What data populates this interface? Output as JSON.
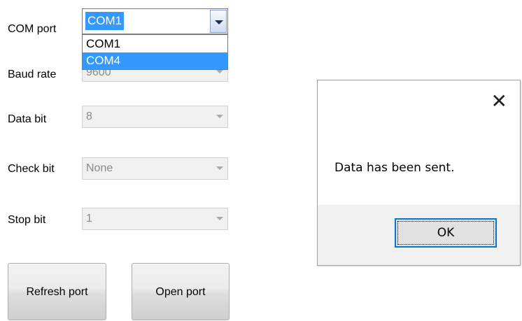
{
  "form": {
    "labels": {
      "com_port": "COM port",
      "baud_rate": "Baud rate",
      "data_bit": "Data bit",
      "check_bit": "Check bit",
      "stop_bit": "Stop bit"
    },
    "com_port": {
      "selected": "COM1",
      "options": [
        "COM1",
        "COM4"
      ],
      "highlighted": "COM4"
    },
    "baud_rate_value": "9600",
    "data_bit_value": "8",
    "check_bit_value": "None",
    "stop_bit_value": "1",
    "buttons": {
      "refresh": "Refresh port",
      "open": "Open port"
    }
  },
  "dialog": {
    "message": "Data has been sent.",
    "ok_label": "OK",
    "close_glyph": "✕"
  },
  "colors": {
    "selection": "#3399ff",
    "ok_border": "#0078d7"
  },
  "icons": [
    "dropdown-arrow-icon",
    "close-icon"
  ]
}
